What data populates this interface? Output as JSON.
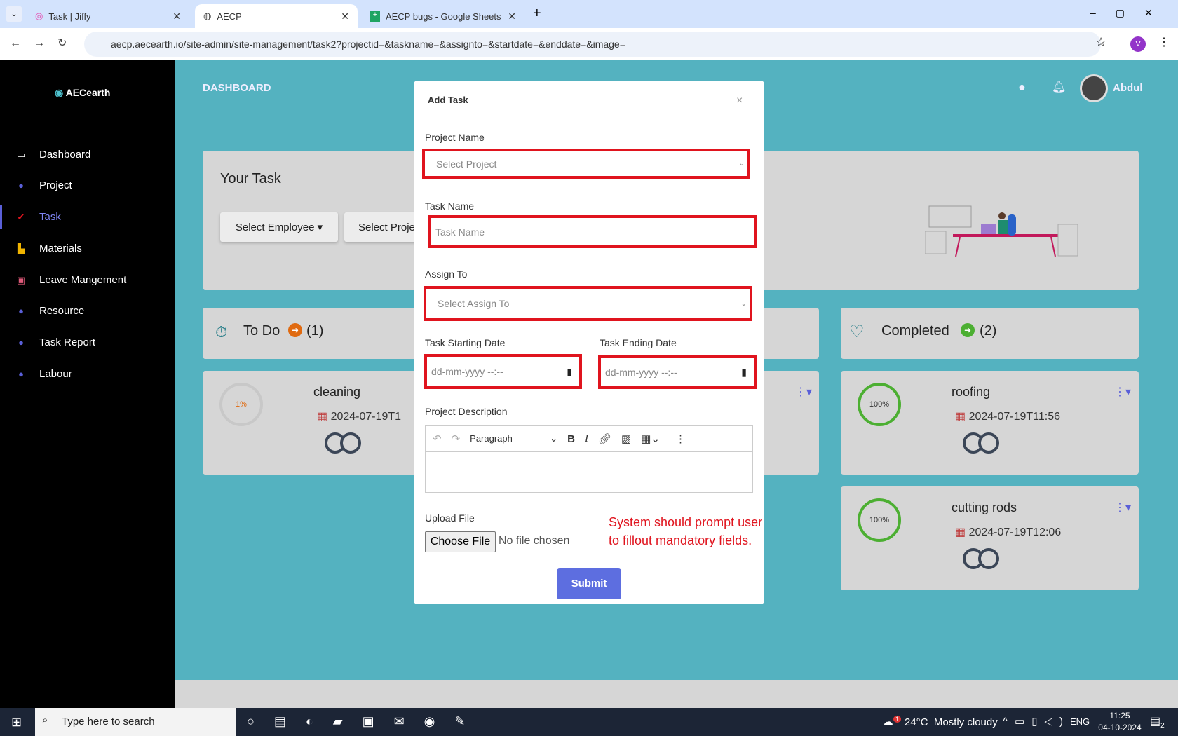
{
  "browser": {
    "tabs": [
      {
        "label": "Task | Jiffy"
      },
      {
        "label": "AECP"
      },
      {
        "label": "AECP bugs - Google Sheets"
      }
    ],
    "url": "aecp.aecearth.io/site-admin/site-management/task2?projectid=&taskname=&assignto=&startdate=&enddate=&image=",
    "profile": "V"
  },
  "sidebar": {
    "logo": "AECearth",
    "items": [
      {
        "label": "Dashboard"
      },
      {
        "label": "Project"
      },
      {
        "label": "Task"
      },
      {
        "label": "Materials"
      },
      {
        "label": "Leave Mangement"
      },
      {
        "label": "Resource"
      },
      {
        "label": "Task Report"
      },
      {
        "label": "Labour"
      }
    ]
  },
  "header": {
    "title": "DASHBOARD",
    "user": "Abdul"
  },
  "your_task": {
    "title": "Your Task",
    "select_employee": "Select Employee",
    "select_project": "Select Proje"
  },
  "todo": {
    "title": "To Do",
    "count": "(1)",
    "tasks": [
      {
        "name": "cleaning",
        "progress": "1%",
        "date": "2024-07-19T1"
      }
    ]
  },
  "completed": {
    "title": "Completed",
    "count": "(2)",
    "tasks": [
      {
        "name": "roofing",
        "progress": "100%",
        "date": "2024-07-19T11:56"
      },
      {
        "name": "cutting rods",
        "progress": "100%",
        "date": "2024-07-19T12:06"
      }
    ]
  },
  "modal": {
    "title": "Add Task",
    "close": "×",
    "project_label": "Project Name",
    "project_placeholder": "Select Project",
    "taskname_label": "Task Name",
    "taskname_placeholder": "Task Name",
    "assign_label": "Assign To",
    "assign_placeholder": "Select Assign To",
    "start_label": "Task Starting Date",
    "end_label": "Task Ending Date",
    "date_placeholder": "dd-mm-yyyy --:--",
    "desc_label": "Project Description",
    "paragraph": "Paragraph",
    "upload_label": "Upload File",
    "choose_file": "Choose File",
    "no_file": "No file chosen",
    "submit": "Submit"
  },
  "annotation": "System should prompt user to fillout mandatory fields.",
  "taskbar": {
    "search": "Type here to search",
    "weather": "24°C  Mostly cloudy",
    "weather_badge": "1",
    "lang": "ENG",
    "time": "11:25",
    "date": "04-10-2024",
    "notif": "2"
  }
}
